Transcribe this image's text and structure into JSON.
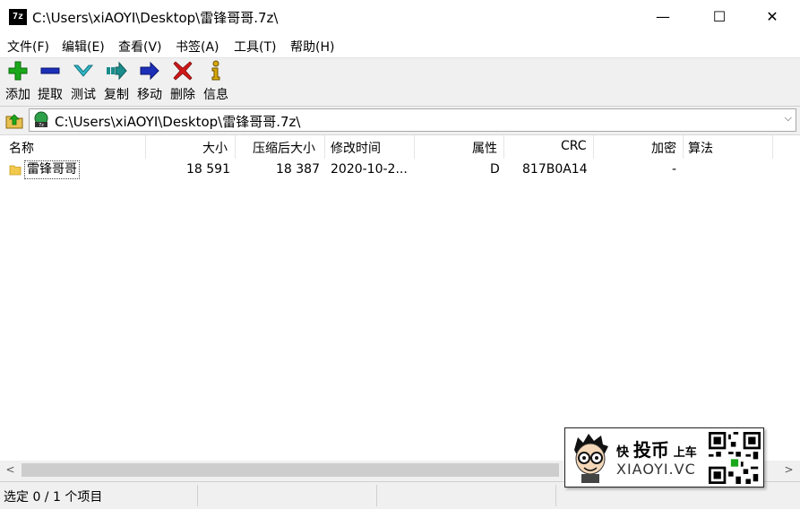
{
  "window": {
    "icon_text": "7z",
    "title": "C:\\Users\\xiAOYI\\Desktop\\雷锋哥哥.7z\\",
    "minimize": "—",
    "maximize": "☐",
    "close": "✕"
  },
  "menu": [
    "文件(F)",
    "编辑(E)",
    "查看(V)",
    "书签(A)",
    "工具(T)",
    "帮助(H)"
  ],
  "toolbar": [
    {
      "label": "添加",
      "icon": "add-icon",
      "color": "#1aa81a"
    },
    {
      "label": "提取",
      "icon": "extract-icon",
      "color": "#1c2fb8"
    },
    {
      "label": "测试",
      "icon": "test-icon",
      "color": "#2fb8c8"
    },
    {
      "label": "复制",
      "icon": "copy-icon",
      "color": "#1a8c8c"
    },
    {
      "label": "移动",
      "icon": "move-icon",
      "color": "#1c2fb8"
    },
    {
      "label": "删除",
      "icon": "delete-icon",
      "color": "#d01818"
    },
    {
      "label": "信息",
      "icon": "info-icon",
      "color": "#d8a800"
    }
  ],
  "address": {
    "path": "C:\\Users\\xiAOYI\\Desktop\\雷锋哥哥.7z\\",
    "dropdown": "⌵"
  },
  "columns": [
    "名称",
    "大小",
    "压缩后大小",
    "修改时间",
    "属性",
    "CRC",
    "加密",
    "算法"
  ],
  "rows": [
    {
      "name": "雷锋哥哥",
      "size": "18 591",
      "packed": "18 387",
      "modified": "2020-10-2...",
      "attr": "D",
      "crc": "817B0A14",
      "encrypted": "-",
      "method": ""
    }
  ],
  "scroll": {
    "left": "<",
    "right": ">"
  },
  "status": {
    "selection": "选定 0 / 1 个项目"
  },
  "watermark": {
    "line1_a": "快",
    "line1_b": "投币",
    "line1_c": "上车",
    "line2": "XIAOYI.VC"
  }
}
